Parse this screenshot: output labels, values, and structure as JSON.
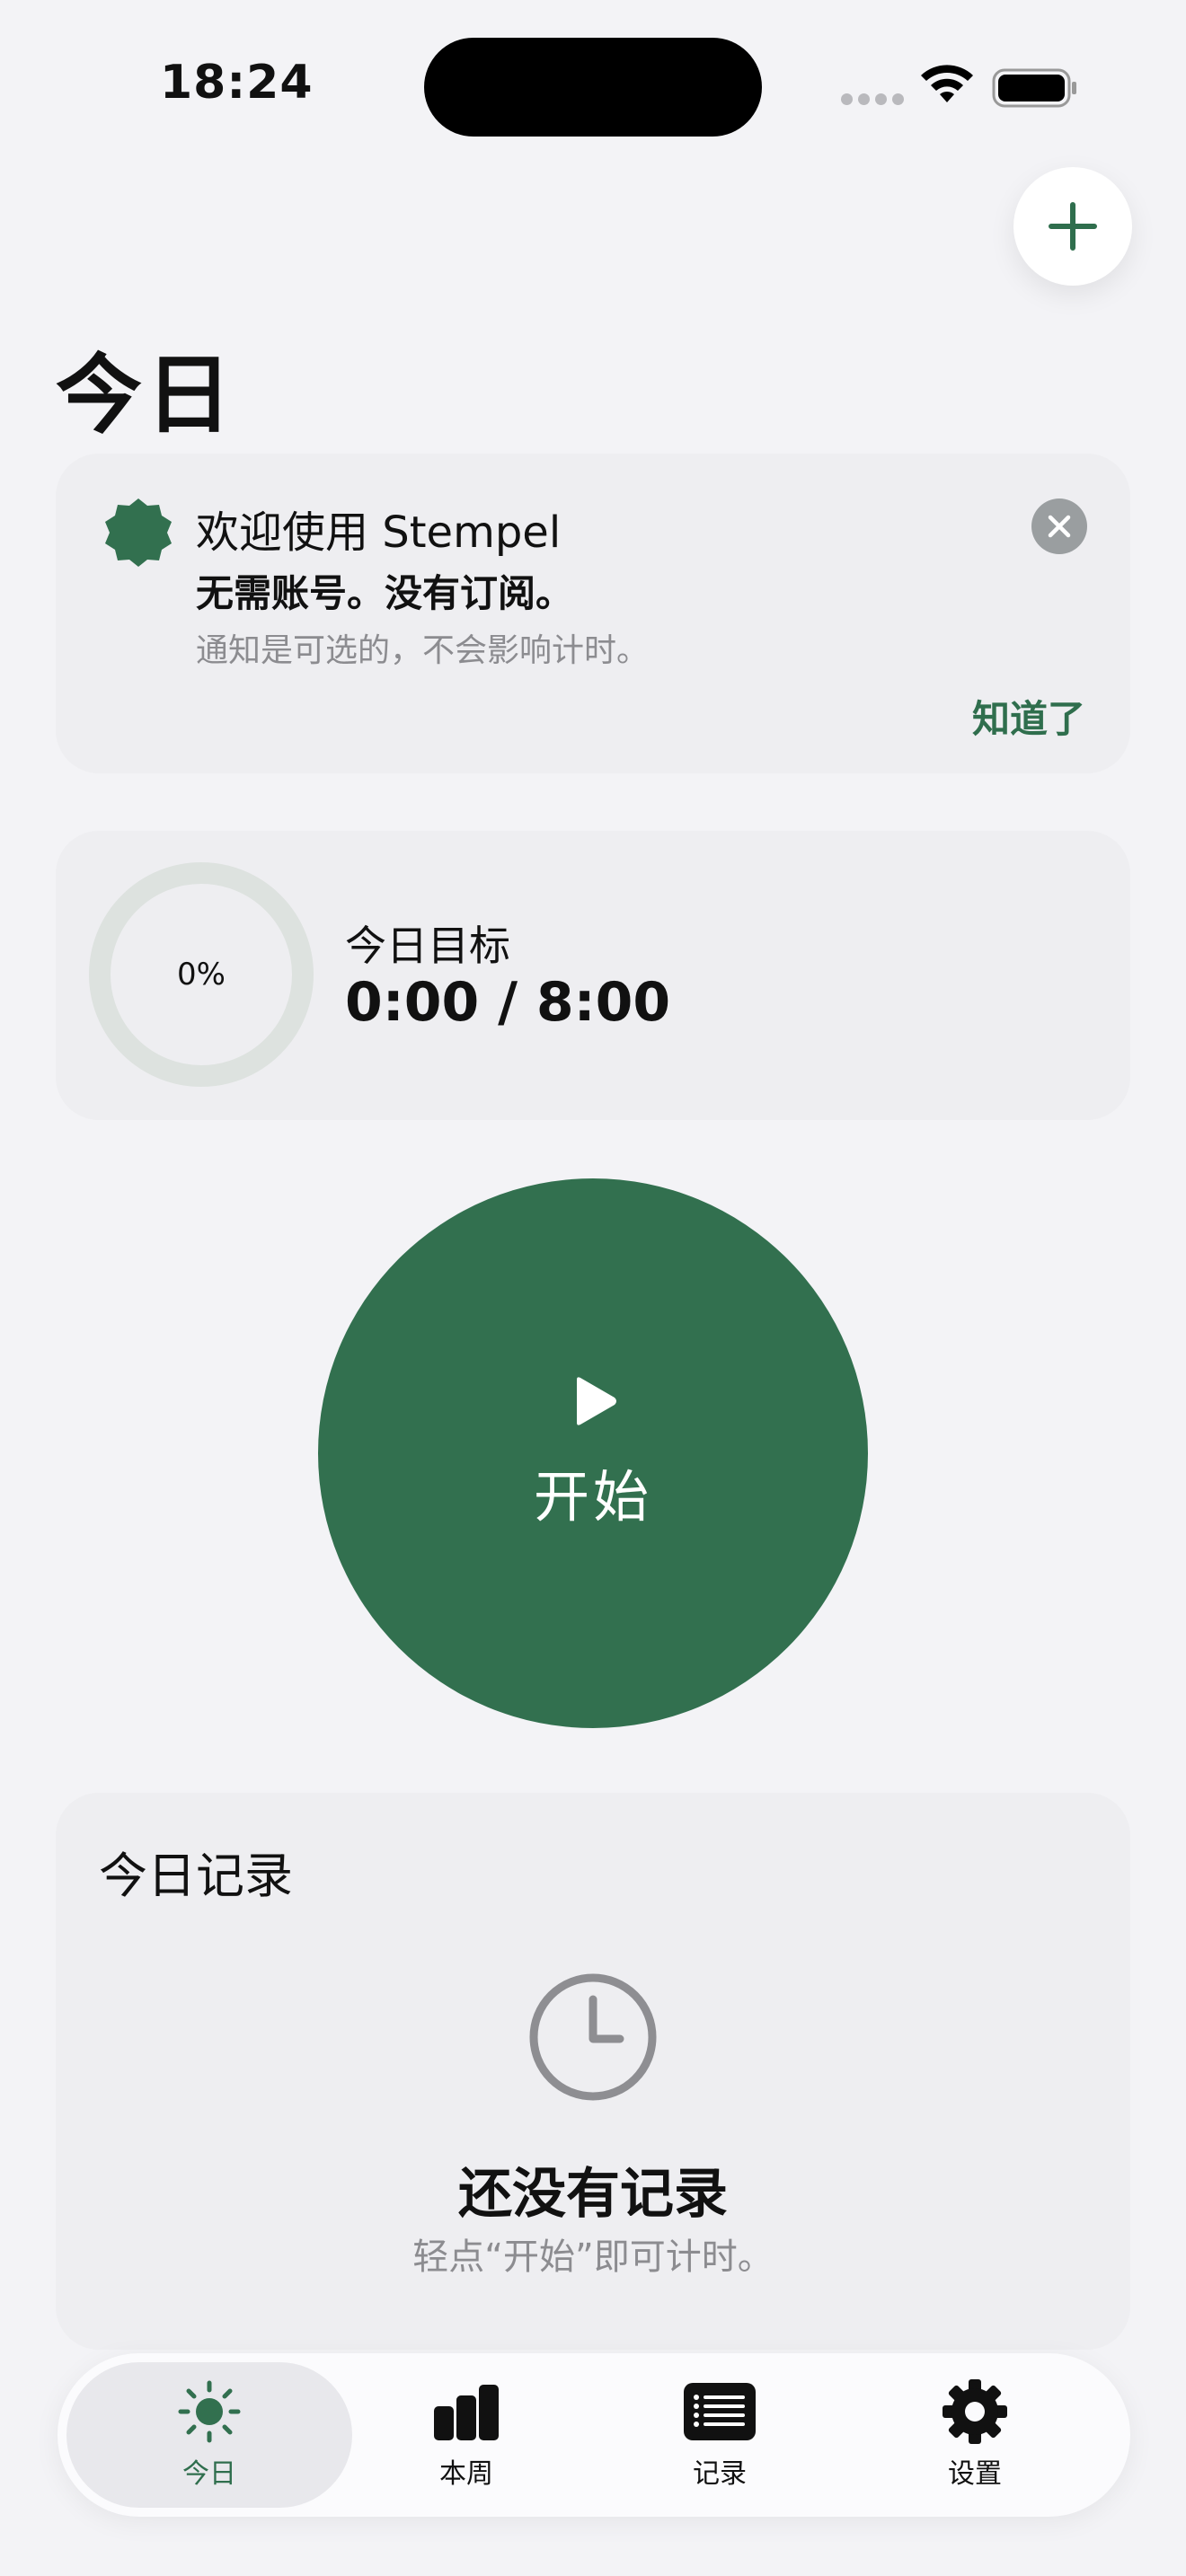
{
  "status_bar": {
    "time": "18:24"
  },
  "page": {
    "title": "今日"
  },
  "welcome": {
    "title": "欢迎使用 Stempel",
    "subtitle": "无需账号。没有订阅。",
    "note": "通知是可选的，不会影响计时。",
    "ack_label": "知道了"
  },
  "goal": {
    "title": "今日目标",
    "value": "0:00 / 8:00",
    "progress_label": "0%",
    "progress": 0
  },
  "start": {
    "label": "开始"
  },
  "records": {
    "title": "今日记录",
    "empty_title": "还没有记录",
    "empty_hint": "轻点“开始”即可计时。"
  },
  "tabs": [
    {
      "label": "今日",
      "icon": "sun-icon"
    },
    {
      "label": "本周",
      "icon": "bar-chart-icon"
    },
    {
      "label": "记录",
      "icon": "list-icon"
    },
    {
      "label": "设置",
      "icon": "gear-icon"
    }
  ],
  "colors": {
    "accent": "#32704f",
    "accent_text": "#2f6e4d",
    "background": "#f3f3f6"
  }
}
